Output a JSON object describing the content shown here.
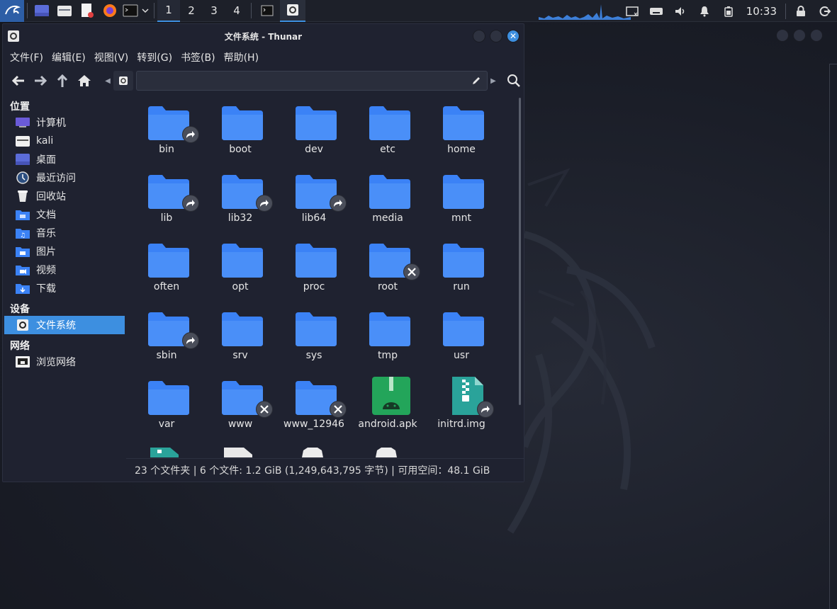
{
  "panel": {
    "workspaces": [
      "1",
      "2",
      "3",
      "4"
    ],
    "active_workspace": "1",
    "clock": "10:33"
  },
  "window": {
    "title": "文件系统 - Thunar",
    "close_glyph": "✕"
  },
  "menu": [
    "文件(F)",
    "编辑(E)",
    "视图(V)",
    "转到(G)",
    "书签(B)",
    "帮助(H)"
  ],
  "sidebar": {
    "sections": [
      {
        "title": "位置",
        "items": [
          {
            "label": "计算机",
            "icon": "computer-icon"
          },
          {
            "label": "kali",
            "icon": "home-folder-icon"
          },
          {
            "label": "桌面",
            "icon": "desktop-icon"
          },
          {
            "label": "最近访问",
            "icon": "recent-icon"
          },
          {
            "label": "回收站",
            "icon": "trash-icon"
          },
          {
            "label": "文档",
            "icon": "documents-folder-icon"
          },
          {
            "label": "音乐",
            "icon": "music-folder-icon"
          },
          {
            "label": "图片",
            "icon": "pictures-folder-icon"
          },
          {
            "label": "视频",
            "icon": "videos-folder-icon"
          },
          {
            "label": "下载",
            "icon": "downloads-folder-icon"
          }
        ]
      },
      {
        "title": "设备",
        "items": [
          {
            "label": "文件系统",
            "icon": "filesystem-icon",
            "selected": true
          }
        ]
      },
      {
        "title": "网络",
        "items": [
          {
            "label": "浏览网络",
            "icon": "network-icon"
          }
        ]
      }
    ]
  },
  "files": [
    {
      "name": "bin",
      "type": "folder",
      "badge": "link"
    },
    {
      "name": "boot",
      "type": "folder"
    },
    {
      "name": "dev",
      "type": "folder"
    },
    {
      "name": "etc",
      "type": "folder"
    },
    {
      "name": "home",
      "type": "folder"
    },
    {
      "name": "lib",
      "type": "folder",
      "badge": "link"
    },
    {
      "name": "lib32",
      "type": "folder",
      "badge": "link"
    },
    {
      "name": "lib64",
      "type": "folder",
      "badge": "link"
    },
    {
      "name": "media",
      "type": "folder"
    },
    {
      "name": "mnt",
      "type": "folder"
    },
    {
      "name": "often",
      "type": "folder"
    },
    {
      "name": "opt",
      "type": "folder"
    },
    {
      "name": "proc",
      "type": "folder"
    },
    {
      "name": "root",
      "type": "folder",
      "badge": "locked"
    },
    {
      "name": "run",
      "type": "folder"
    },
    {
      "name": "sbin",
      "type": "folder",
      "badge": "link"
    },
    {
      "name": "srv",
      "type": "folder"
    },
    {
      "name": "sys",
      "type": "folder"
    },
    {
      "name": "tmp",
      "type": "folder"
    },
    {
      "name": "usr",
      "type": "folder"
    },
    {
      "name": "var",
      "type": "folder"
    },
    {
      "name": "www",
      "type": "folder",
      "badge": "locked"
    },
    {
      "name": "www_12946",
      "type": "folder",
      "badge": "locked"
    },
    {
      "name": "android.apk",
      "type": "apk"
    },
    {
      "name": "initrd.img",
      "type": "archive",
      "badge": "link"
    }
  ],
  "status": "23 个文件夹 | 6 个文件: 1.2 GiB (1,249,643,795 字节) | 可用空间：48.1 GiB",
  "colors": {
    "accent": "#3d8fe0",
    "folder": "#3b82f6",
    "panel": "#1d2029"
  }
}
